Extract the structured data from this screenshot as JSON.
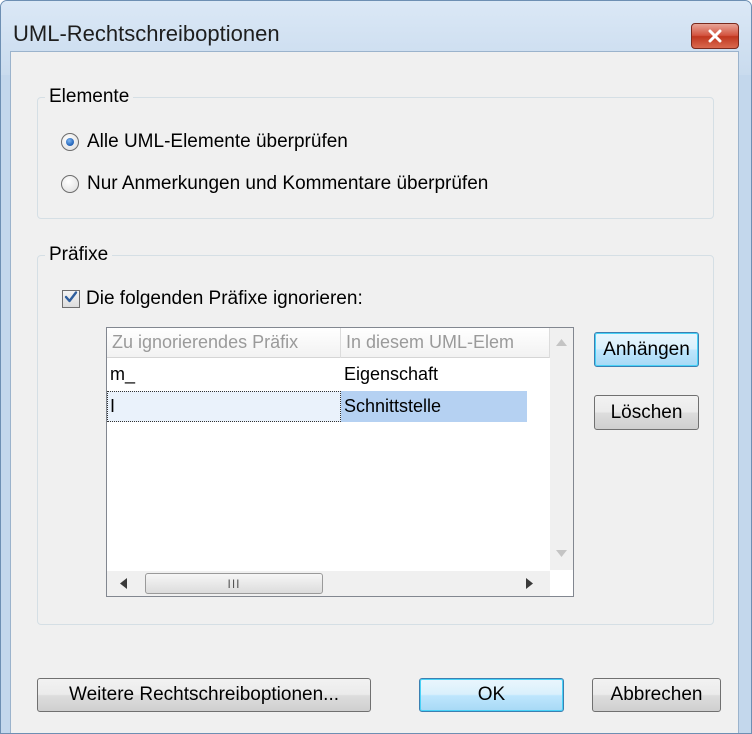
{
  "dialog": {
    "title": "UML-Rechtschreiboptionen"
  },
  "elements_group": {
    "legend": "Elemente",
    "options": [
      {
        "label": "Alle UML-Elemente überprüfen",
        "selected": true
      },
      {
        "label": "Nur Anmerkungen und Kommentare überprüfen",
        "selected": false
      }
    ]
  },
  "prefix_group": {
    "legend": "Präfixe",
    "ignore_checkbox": {
      "label": "Die folgenden Präfixe ignorieren:",
      "checked": true
    },
    "table": {
      "columns": [
        "Zu ignorierendes Präfix",
        "In diesem UML-Elem"
      ],
      "rows": [
        [
          "m_",
          "Eigenschaft"
        ],
        [
          "I",
          "Schnittstelle"
        ]
      ],
      "selected_row": 1
    },
    "scroll": {
      "thumb_glyph": "III"
    }
  },
  "side_buttons": {
    "append": "Anhängen",
    "delete": "Löschen"
  },
  "footer": {
    "more_options": "Weitere Rechtschreiboptionen...",
    "ok": "OK",
    "cancel": "Abbrechen"
  },
  "colors": {
    "selection": "#cce0f7",
    "default_button_border": "#3c7fb1",
    "close_button": "#c0361f"
  },
  "icons": {
    "close": "close-icon",
    "checkbox": "checkmark-icon"
  }
}
